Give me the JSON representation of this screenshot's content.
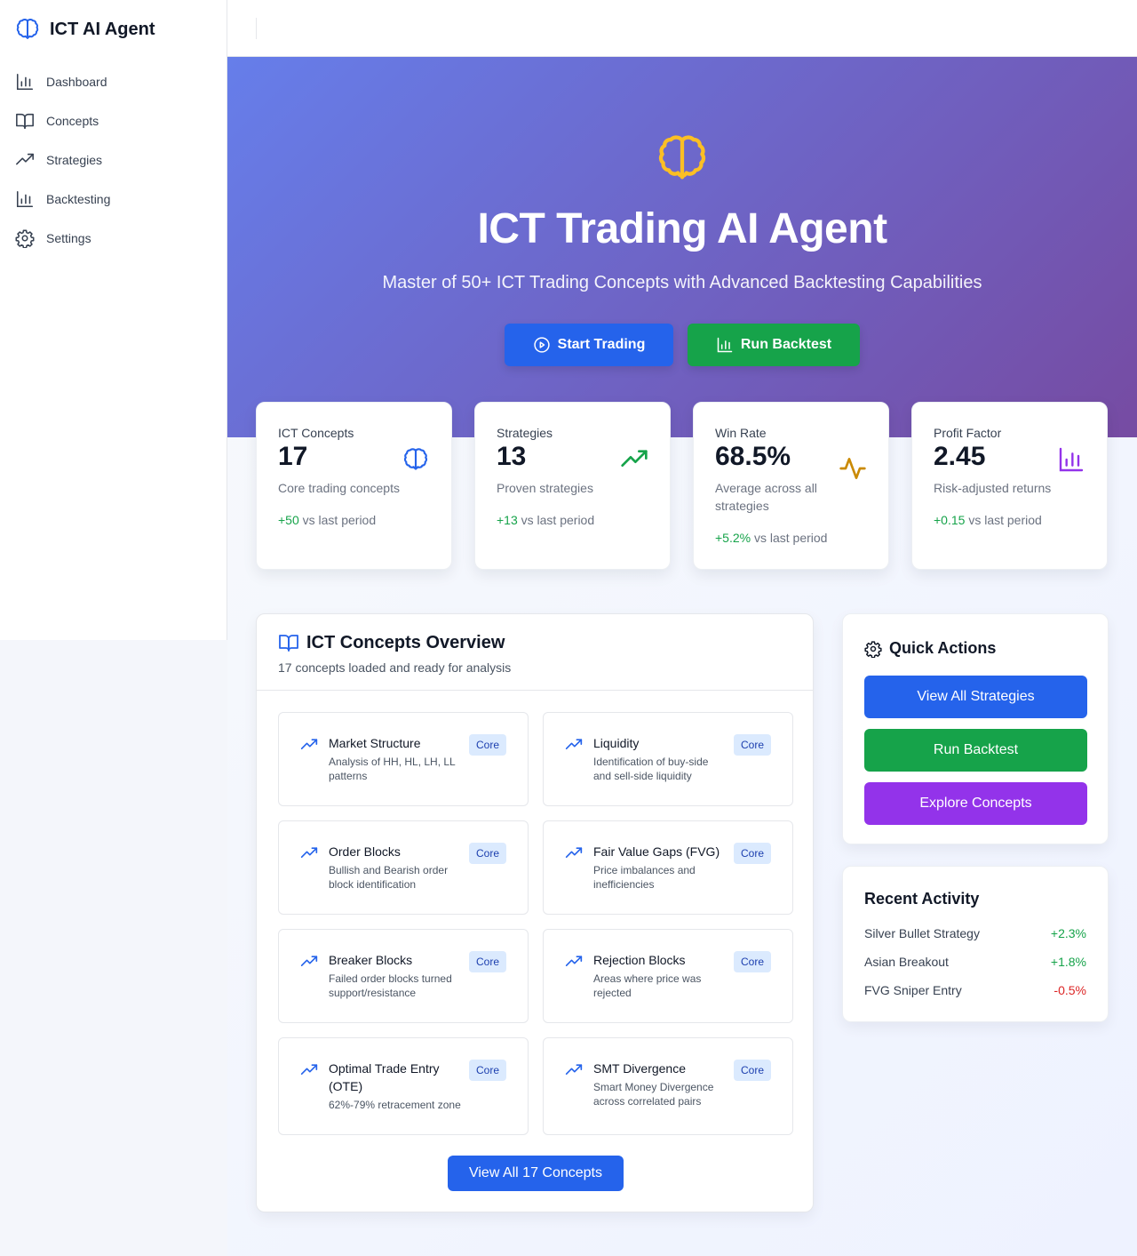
{
  "colors": {
    "accent_blue": "#2563eb",
    "accent_green": "#16a34a",
    "accent_purple": "#9333ea",
    "hero_gradient_start": "#667eea",
    "hero_gradient_end": "#764ba2",
    "hero_icon": "#fbbf24",
    "warning_icon": "#ca8a04",
    "negative": "#dc2626"
  },
  "sidebar": {
    "brand": {
      "title": "ICT AI Agent",
      "icon": "brain-icon"
    },
    "items": [
      {
        "label": "Dashboard",
        "icon": "bar-chart-icon"
      },
      {
        "label": "Concepts",
        "icon": "book-open-icon"
      },
      {
        "label": "Strategies",
        "icon": "trending-up-icon"
      },
      {
        "label": "Backtesting",
        "icon": "bar-chart-icon"
      },
      {
        "label": "Settings",
        "icon": "gear-icon"
      }
    ]
  },
  "hero": {
    "icon": "brain-icon",
    "title": "ICT Trading AI Agent",
    "subtitle": "Master of 50+ ICT Trading Concepts with Advanced Backtesting Capabilities",
    "buttons": [
      {
        "label": "Start Trading",
        "icon": "play-circle-icon"
      },
      {
        "label": "Run Backtest",
        "icon": "bar-chart-icon"
      }
    ]
  },
  "stats": [
    {
      "label": "ICT Concepts",
      "value": "17",
      "description": "Core trading concepts",
      "change": "+50",
      "change_suffix": "vs last period",
      "icon": "brain-icon"
    },
    {
      "label": "Strategies",
      "value": "13",
      "description": "Proven strategies",
      "change": "+13",
      "change_suffix": "vs last period",
      "icon": "trending-up-icon"
    },
    {
      "label": "Win Rate",
      "value": "68.5%",
      "description": "Average across all strategies",
      "change": "+5.2%",
      "change_suffix": "vs last period",
      "icon": "activity-icon"
    },
    {
      "label": "Profit Factor",
      "value": "2.45",
      "description": "Risk-adjusted returns",
      "change": "+0.15",
      "change_suffix": "vs last period",
      "icon": "bar-chart-icon"
    }
  ],
  "concepts_panel": {
    "title": "ICT Concepts Overview",
    "subtitle": "17 concepts loaded and ready for analysis",
    "icon": "book-open-icon",
    "items": [
      {
        "name": "Market Structure",
        "description": "Analysis of HH, HL, LH, LL patterns",
        "badge": "Core"
      },
      {
        "name": "Liquidity",
        "description": "Identification of buy-side and sell-side liquidity",
        "badge": "Core"
      },
      {
        "name": "Order Blocks",
        "description": "Bullish and Bearish order block identification",
        "badge": "Core"
      },
      {
        "name": "Fair Value Gaps (FVG)",
        "description": "Price imbalances and inefficiencies",
        "badge": "Core"
      },
      {
        "name": "Breaker Blocks",
        "description": "Failed order blocks turned support/resistance",
        "badge": "Core"
      },
      {
        "name": "Rejection Blocks",
        "description": "Areas where price was rejected",
        "badge": "Core"
      },
      {
        "name": "Optimal Trade Entry (OTE)",
        "description": "62%-79% retracement zone",
        "badge": "Core"
      },
      {
        "name": "SMT Divergence",
        "description": "Smart Money Divergence across correlated pairs",
        "badge": "Core"
      }
    ],
    "view_all_label": "View All 17 Concepts"
  },
  "quick_actions": {
    "title": "Quick Actions",
    "icon": "gear-icon",
    "buttons": [
      {
        "label": "View All Strategies"
      },
      {
        "label": "Run Backtest"
      },
      {
        "label": "Explore Concepts"
      }
    ]
  },
  "recent_activity": {
    "title": "Recent Activity",
    "items": [
      {
        "name": "Silver Bullet Strategy",
        "value": "+2.3%"
      },
      {
        "name": "Asian Breakout",
        "value": "+1.8%"
      },
      {
        "name": "FVG Sniper Entry",
        "value": "-0.5%"
      }
    ]
  }
}
